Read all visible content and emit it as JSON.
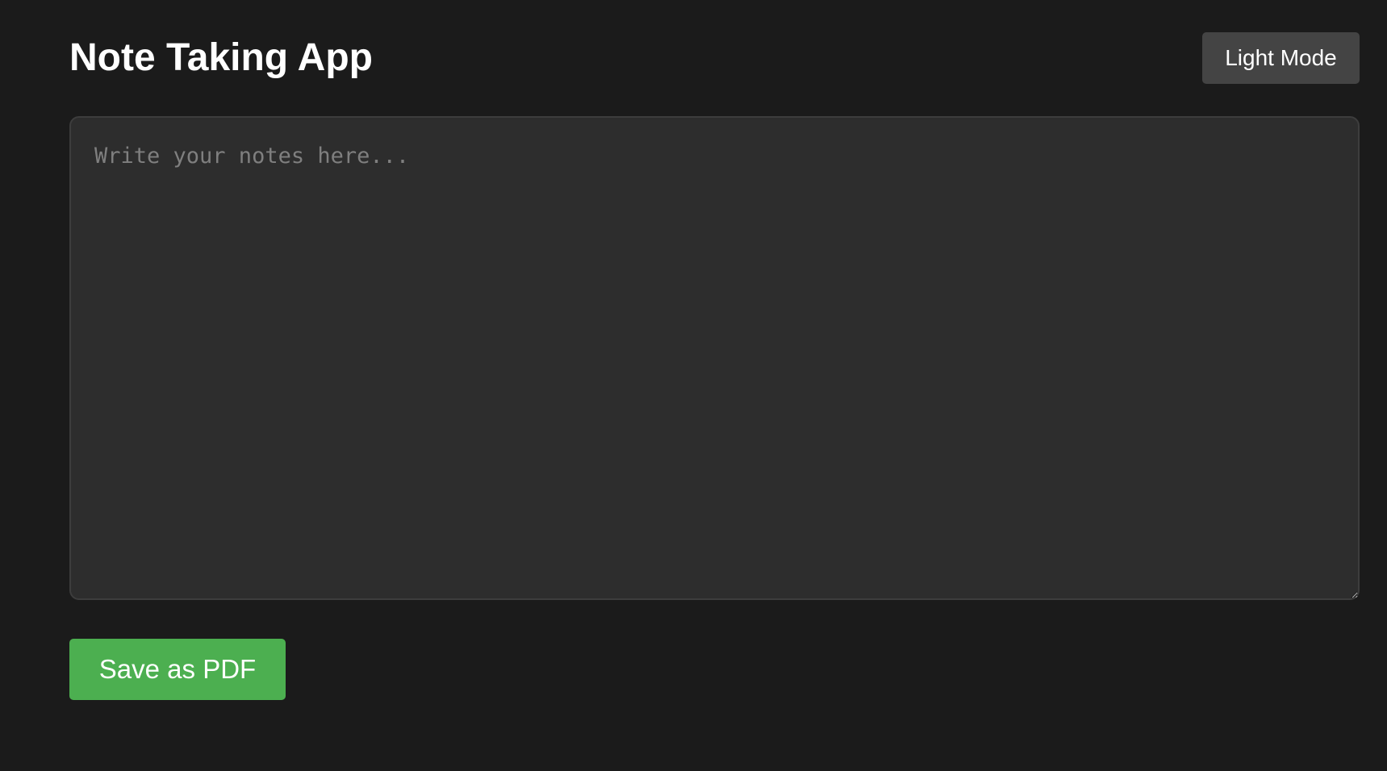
{
  "app": {
    "title": "Note Taking App"
  },
  "header": {
    "theme_toggle_label": "Light Mode"
  },
  "editor": {
    "placeholder": "Write your notes here...",
    "value": ""
  },
  "actions": {
    "save_pdf_label": "Save as PDF"
  },
  "colors": {
    "background": "#1b1b1b",
    "editor_background": "#2d2d2d",
    "toggle_background": "#444444",
    "save_button": "#4caf50"
  }
}
